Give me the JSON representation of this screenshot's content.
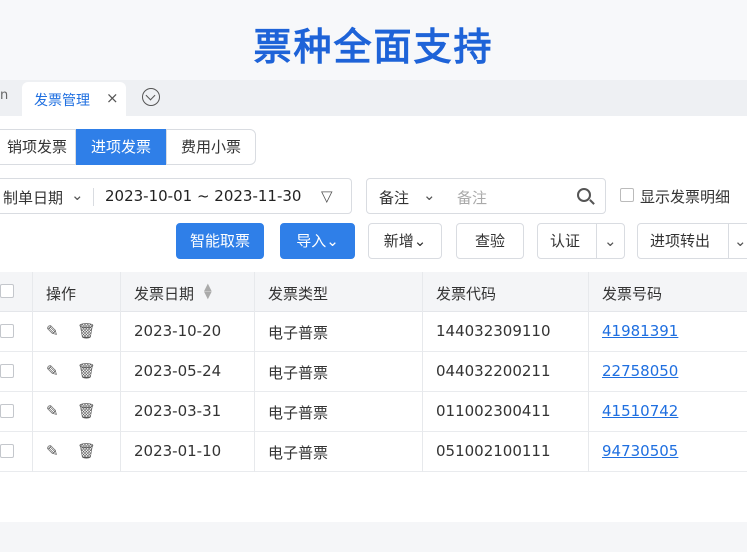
{
  "banner": {
    "title": "票种全面支持"
  },
  "tabs": {
    "home_stub": "n",
    "active_label": "发票管理",
    "close": "×"
  },
  "segments": [
    "销项发票",
    "进项发票",
    "费用小票"
  ],
  "filters": {
    "date_field": "制单日期",
    "date_range": "2023-10-01 ~ 2023-11-30",
    "note_field": "备注",
    "note_placeholder": "备注",
    "show_detail_label": "显示发票明细"
  },
  "toolbar": {
    "smart": "智能取票",
    "import": "导入",
    "new": "新增",
    "check": "查验",
    "auth": "认证",
    "transfer": "进项转出"
  },
  "table": {
    "headers": [
      "操作",
      "发票日期",
      "发票类型",
      "发票代码",
      "发票号码"
    ],
    "rows": [
      {
        "date": "2023-10-20",
        "type": "电子普票",
        "code": "144032309110",
        "number": "41981391"
      },
      {
        "date": "2023-05-24",
        "type": "电子普票",
        "code": "044032200211",
        "number": "22758050"
      },
      {
        "date": "2023-03-31",
        "type": "电子普票",
        "code": "011002300411",
        "number": "41510742"
      },
      {
        "date": "2023-01-10",
        "type": "电子普票",
        "code": "051002100111",
        "number": "94730505"
      }
    ]
  }
}
